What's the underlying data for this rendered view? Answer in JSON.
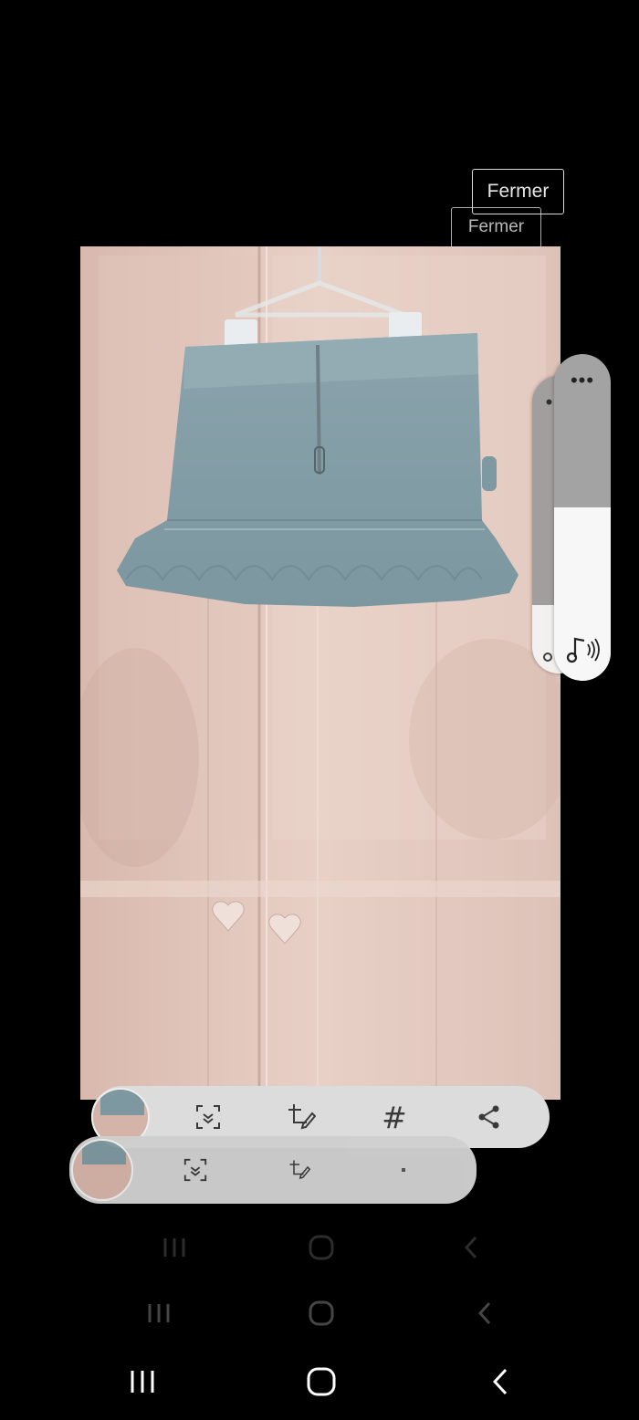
{
  "overlay": {
    "close_label_primary": "Fermer",
    "close_label_secondary": "Fermer"
  },
  "volume_panel": {
    "more_options_glyph": "•••",
    "level_front": 0.53,
    "level_back": 0.23,
    "stream": "media"
  },
  "image_toolbar": {
    "buttons": [
      "thumbnail",
      "scan-icon",
      "crop-edit-icon",
      "hashtag-icon",
      "share-icon"
    ],
    "hashtag_glyph": "#"
  },
  "navigation": {
    "buttons": [
      "recent-apps",
      "home",
      "back"
    ]
  },
  "colors": {
    "background": "#000000",
    "toolbar": "#dcdcdc",
    "volume_track": "#a3a3a3",
    "volume_fill": "#f7f7f7",
    "icon": "#3a3a3a"
  }
}
